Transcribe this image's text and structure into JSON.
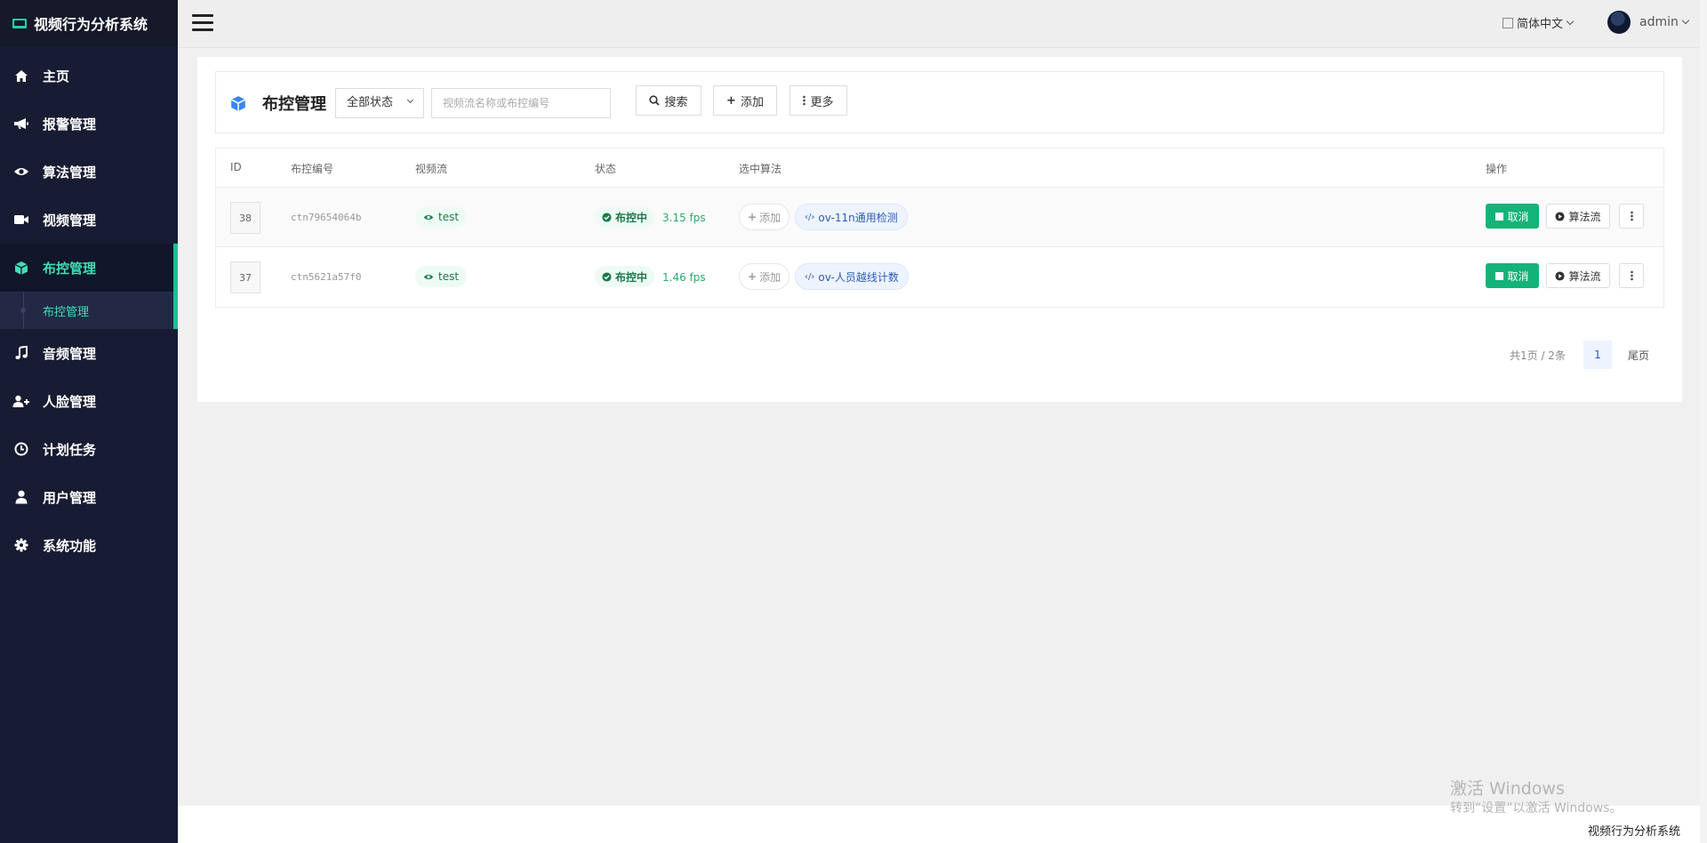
{
  "app": {
    "title": "视频行为分析系统"
  },
  "sidebar": {
    "items": [
      {
        "label": "主页",
        "icon": "home-icon"
      },
      {
        "label": "报警管理",
        "icon": "megaphone-icon"
      },
      {
        "label": "算法管理",
        "icon": "eye-icon"
      },
      {
        "label": "视频管理",
        "icon": "video-camera-icon"
      },
      {
        "label": "布控管理",
        "icon": "cube-icon",
        "active": true
      },
      {
        "label": "音频管理",
        "icon": "music-note-icon"
      },
      {
        "label": "人脸管理",
        "icon": "user-plus-icon"
      },
      {
        "label": "计划任务",
        "icon": "clock-icon"
      },
      {
        "label": "用户管理",
        "icon": "user-icon"
      },
      {
        "label": "系统功能",
        "icon": "gear-icon"
      }
    ],
    "sub_item": "布控管理"
  },
  "topbar": {
    "language": "简体中文",
    "username": "admin"
  },
  "toolbar": {
    "title": "布控管理",
    "status_select": "全部状态",
    "search_placeholder": "视频流名称或布控编号",
    "search_label": "搜索",
    "add_label": "添加",
    "more_label": "更多"
  },
  "table": {
    "headers": [
      "ID",
      "布控编号",
      "视频流",
      "状态",
      "选中算法",
      "操作"
    ],
    "rows": [
      {
        "id": "38",
        "code": "ctn79654064b",
        "stream": "test",
        "status": "布控中",
        "fps": "3.15 fps",
        "add": "添加",
        "algorithm": "ov-11n通用检测",
        "cancel": "取消",
        "flow": "算法流"
      },
      {
        "id": "37",
        "code": "ctn5621a57f0",
        "stream": "test",
        "status": "布控中",
        "fps": "1.46 fps",
        "add": "添加",
        "algorithm": "ov-人员越线计数",
        "cancel": "取消",
        "flow": "算法流"
      }
    ]
  },
  "pagination": {
    "summary": "共1页 / 2条",
    "current": "1",
    "last": "尾页"
  },
  "footer": {
    "text": "视频行为分析系统"
  },
  "watermark": {
    "line1": "激活 Windows",
    "line2": "转到“设置”以激活 Windows。"
  },
  "colors": {
    "sidebar_bg": "#181c33",
    "accent_green": "#14b377",
    "active_text": "#3ddfb5",
    "algo_blue": "#2b5bbd"
  }
}
